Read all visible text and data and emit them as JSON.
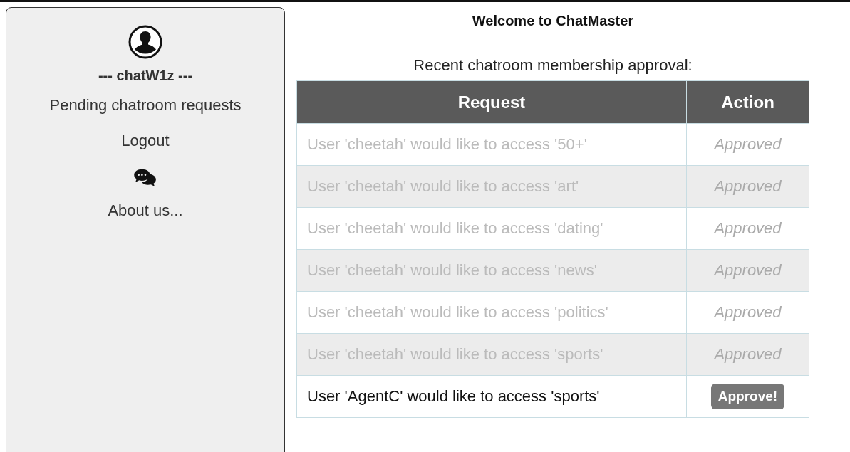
{
  "title": "Welcome to ChatMaster",
  "sidebar": {
    "username": "--- chatW1z ---",
    "items": [
      {
        "kind": "link",
        "label": "Pending chatroom requests"
      },
      {
        "kind": "link",
        "label": "Logout"
      },
      {
        "kind": "chat-icon"
      },
      {
        "kind": "link",
        "label": "About us..."
      }
    ]
  },
  "table": {
    "caption": "Recent chatroom membership approval:",
    "columns": [
      "Request",
      "Action"
    ],
    "rows": [
      {
        "kind": "approved",
        "request": "User 'cheetah' would like to access '50+'",
        "action": "Approved"
      },
      {
        "kind": "approved",
        "request": "User 'cheetah' would like to access 'art'",
        "action": "Approved"
      },
      {
        "kind": "approved",
        "request": "User 'cheetah' would like to access 'dating'",
        "action": "Approved"
      },
      {
        "kind": "approved",
        "request": "User 'cheetah' would like to access 'news'",
        "action": "Approved"
      },
      {
        "kind": "approved",
        "request": "User 'cheetah' would like to access 'politics'",
        "action": "Approved"
      },
      {
        "kind": "approved",
        "request": "User 'cheetah' would like to access 'sports'",
        "action": "Approved"
      },
      {
        "kind": "pending",
        "request": "User 'AgentC' would like to access 'sports'",
        "action": "Approve!"
      }
    ]
  }
}
